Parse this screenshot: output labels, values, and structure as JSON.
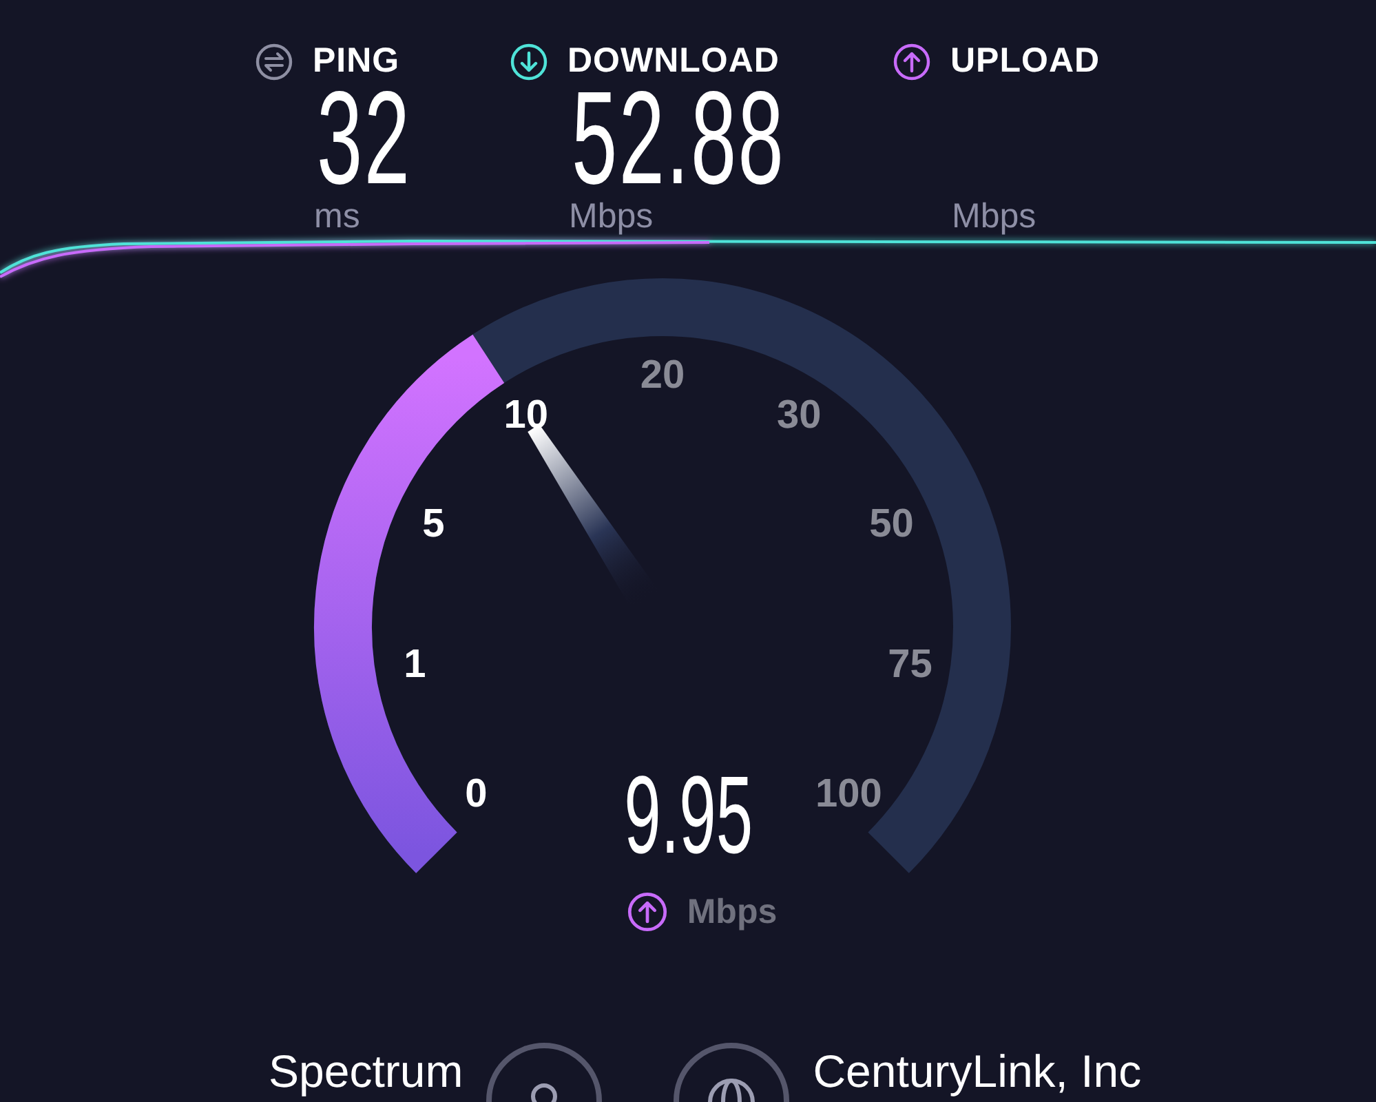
{
  "metrics": [
    {
      "kind": "ping",
      "label": "PING",
      "value": "32",
      "unit": "ms"
    },
    {
      "kind": "download",
      "label": "DOWNLOAD",
      "value": "52.88",
      "unit": "Mbps"
    },
    {
      "kind": "upload",
      "label": "UPLOAD",
      "unit": "Mbps"
    }
  ],
  "gauge": {
    "value": "9.95",
    "unit": "Mbps",
    "kind": "upload",
    "ticks": [
      {
        "label": "0",
        "reached": true
      },
      {
        "label": "1",
        "reached": true
      },
      {
        "label": "5",
        "reached": true
      },
      {
        "label": "10",
        "reached": true
      },
      {
        "label": "20",
        "reached": false
      },
      {
        "label": "30",
        "reached": false
      },
      {
        "label": "50",
        "reached": false
      },
      {
        "label": "75",
        "reached": false
      },
      {
        "label": "100",
        "reached": false
      }
    ]
  },
  "connection": {
    "provider": "Spectrum",
    "server": "CenturyLink, Inc"
  }
}
